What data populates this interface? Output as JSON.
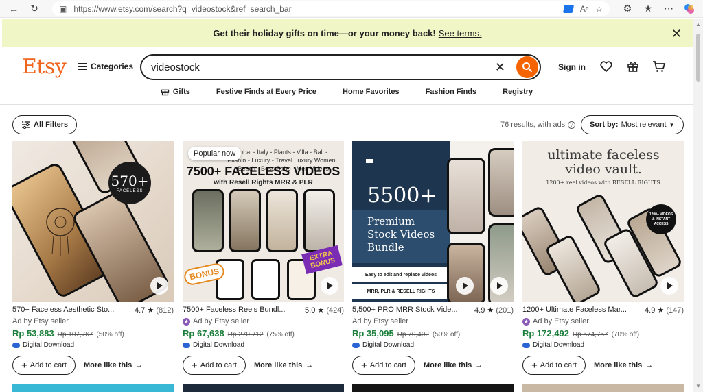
{
  "browser": {
    "url": "https://www.etsy.com/search?q=videostock&ref=search_bar"
  },
  "banner": {
    "text": "Get their holiday gifts on time—or your money back!",
    "link": "See terms."
  },
  "header": {
    "logo": "Etsy",
    "categories": "Categories",
    "search_value": "videostock",
    "signin": "Sign in"
  },
  "nav": {
    "items": [
      "Gifts",
      "Festive Finds at Every Price",
      "Home Favorites",
      "Fashion Finds",
      "Registry"
    ]
  },
  "toolbar": {
    "filters": "All Filters",
    "results": "76 results, with ads",
    "sort_label": "Sort by:",
    "sort_value": "Most relevant"
  },
  "products": [
    {
      "title": "570+ Faceless Aesthetic Sto...",
      "rating": "4.7",
      "count": "(812)",
      "seller": "Ad by Etsy seller",
      "price": "Rp 53,883",
      "original": "Rp 107,767",
      "discount": "(50% off)",
      "download": "Digital Download",
      "cart": "Add to cart",
      "more": "More like this",
      "image_text": "570+",
      "image_sub": "FACELESS"
    },
    {
      "title": "7500+ Faceless Reels Bundl...",
      "rating": "5.0",
      "count": "(424)",
      "seller": "Ad by Etsy seller",
      "price": "Rp 67,638",
      "original": "Rp 270,712",
      "discount": "(75% off)",
      "download": "Digital Download",
      "cart": "Add to cart",
      "more": "More like this",
      "badge": "Popular now",
      "image_top": "Dubai - Italy - Plants - Villa - Bali - Pilanin - Luxury - Travel  Luxury Women - Beach - Boss Babe - Men Videos",
      "image_text": "7500+ FACELESS VIDEOS",
      "image_sub": "with Resell Rights MRR & PLR",
      "bonus": "BONUS",
      "extra": "EXTRA BONUS"
    },
    {
      "title": "5,500+ PRO MRR Stock Vide...",
      "rating": "4.9",
      "count": "(201)",
      "seller": "Ad by Etsy seller",
      "price": "Rp 35,095",
      "original": "Rp 70,402",
      "discount": "(50% off)",
      "download": "Digital Download",
      "cart": "Add to cart",
      "more": "More like this",
      "image_text": "5500+",
      "image_sub": "Premium Stock Videos Bundle",
      "image_note": "Easy to edit and replace videos",
      "image_note2": "MRR, PLR & RESELL RIGHTS"
    },
    {
      "title": "1200+ Ultimate Faceless Mar...",
      "rating": "4.9",
      "count": "(147)",
      "seller": "Ad by Etsy seller",
      "price": "Rp 172,492",
      "original": "Rp 574,757",
      "discount": "(70% off)",
      "download": "Digital Download",
      "cart": "Add to cart",
      "more": "More like this",
      "image_text": "ultimate faceless video vault.",
      "image_sub": "1200+ reel videos with RESELL RIGHTS",
      "image_badge": "1200+ VIDEOS & INSTANT ACCESS"
    }
  ],
  "colors": {
    "brand": "#f1641e",
    "search_button": "#f56400",
    "banner_bg": "#f1f6c6",
    "price": "#1b7f3b"
  }
}
